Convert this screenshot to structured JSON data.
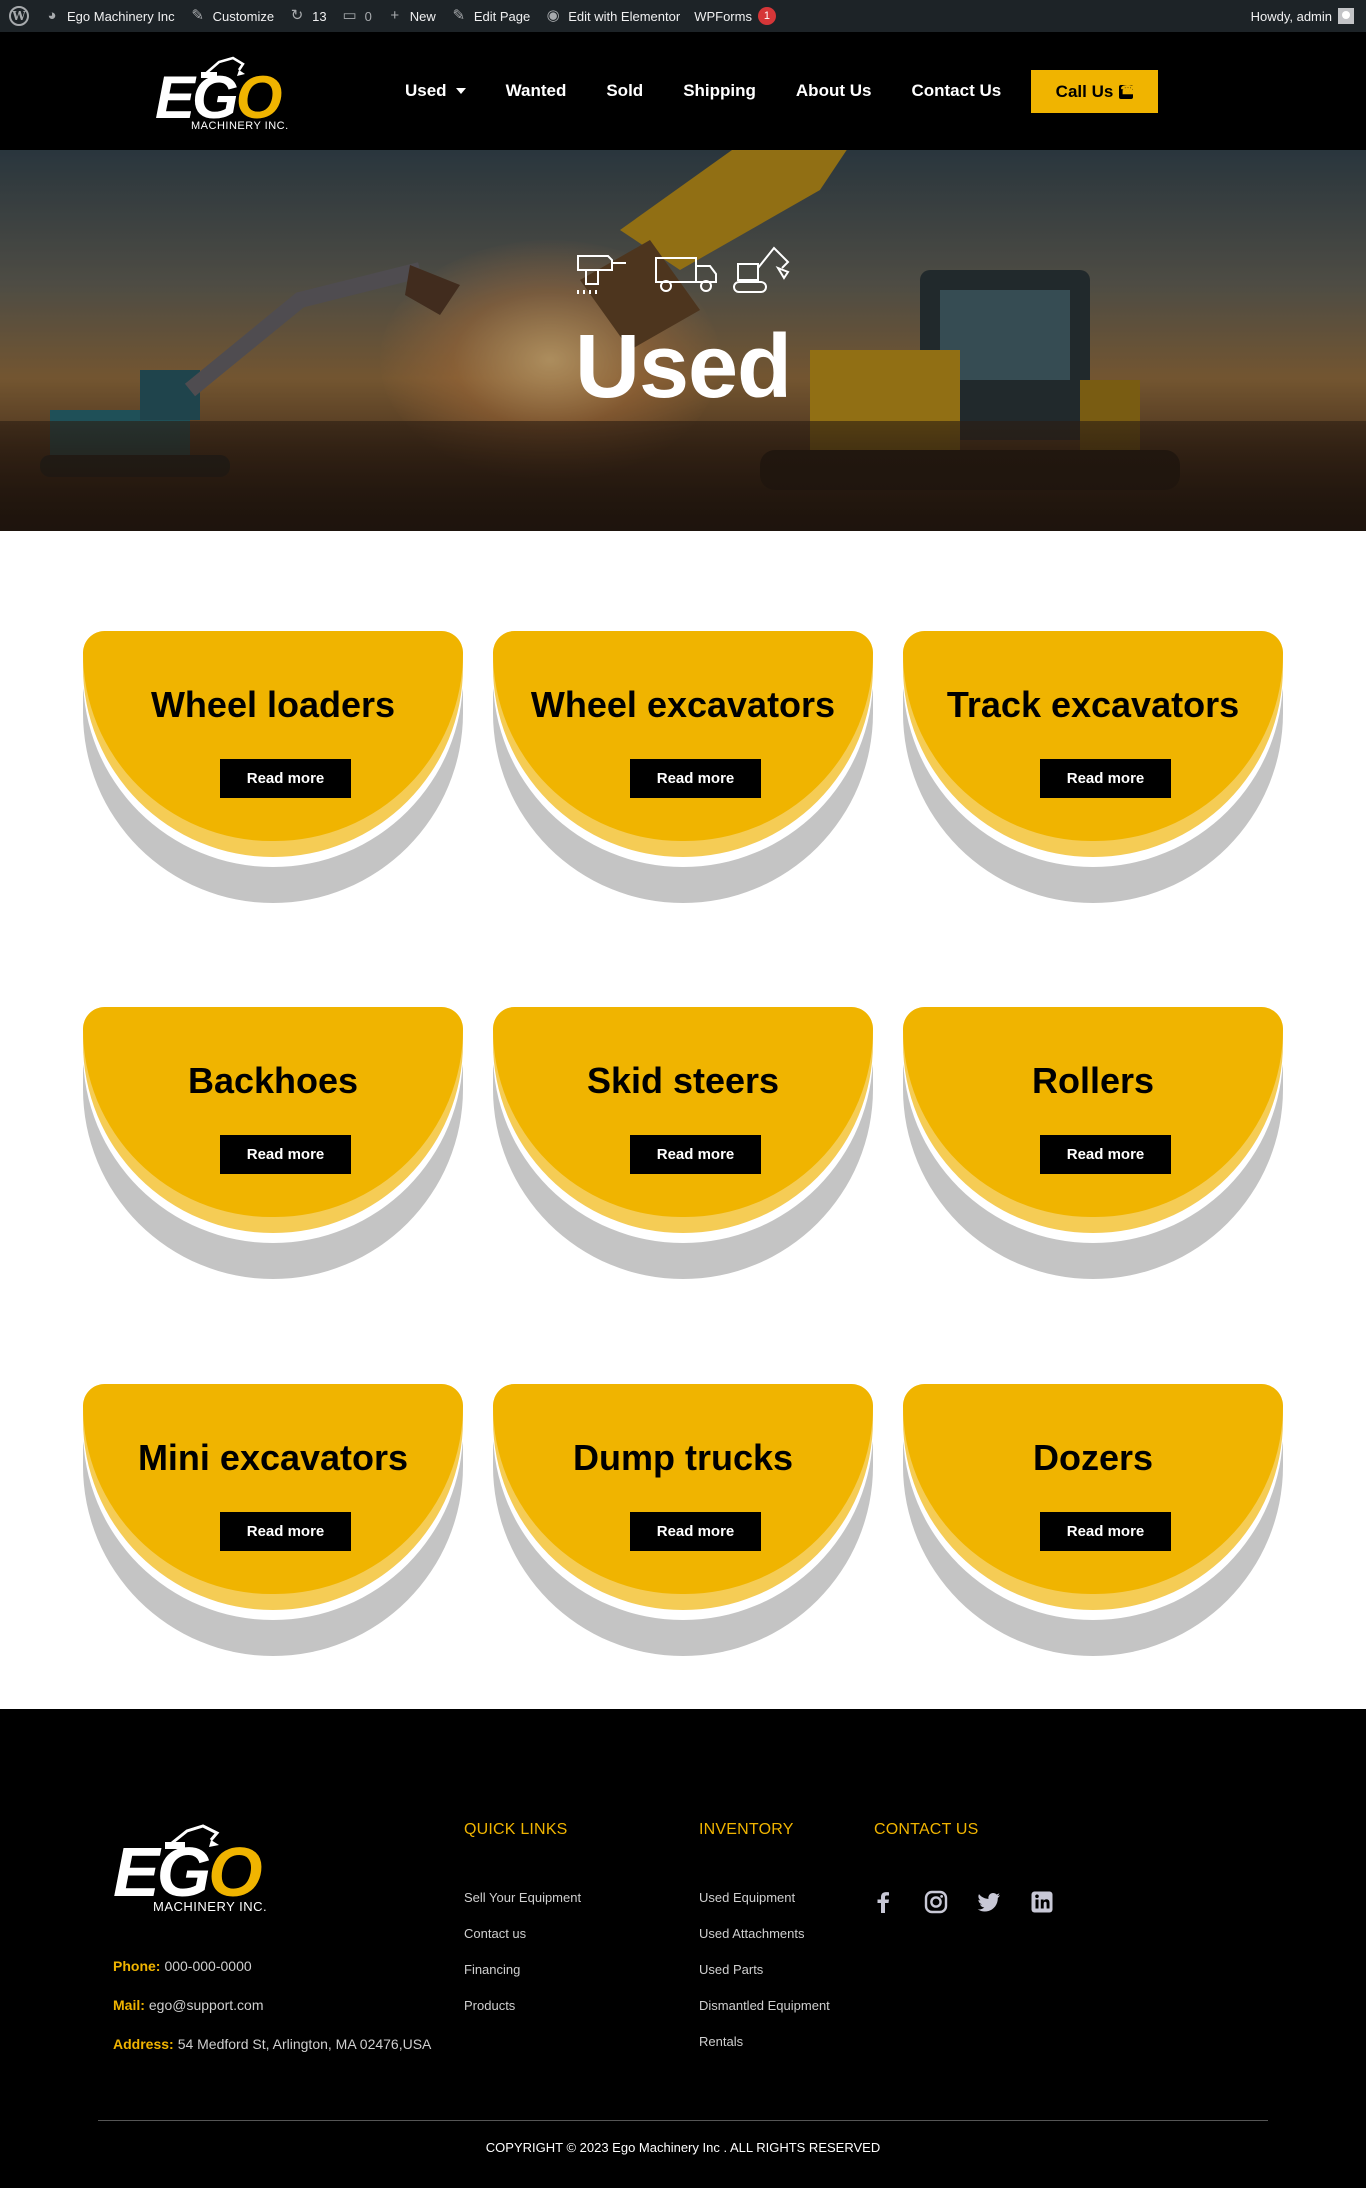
{
  "adminbar": {
    "site_name": "Ego Machinery Inc",
    "customize": "Customize",
    "updates_count": "13",
    "comments_count": "0",
    "new_label": "New",
    "edit_page": "Edit Page",
    "edit_elementor": "Edit with Elementor",
    "wpforms": "WPForms",
    "wpforms_badge": "1",
    "howdy": "Howdy, admin"
  },
  "header": {
    "logo_word_white": "EG",
    "logo_word_yellow": "O",
    "logo_sub": "MACHINERY INC.",
    "nav": [
      "Used",
      "Wanted",
      "Sold",
      "Shipping",
      "About Us",
      "Contact Us"
    ],
    "call_button": "Call Us"
  },
  "hero": {
    "title": "Used"
  },
  "categories": [
    {
      "title": "Wheel loaders",
      "button": "Read more"
    },
    {
      "title": "Wheel excavators",
      "button": "Read more"
    },
    {
      "title": "Track excavators",
      "button": "Read more"
    },
    {
      "title": "Backhoes",
      "button": "Read more"
    },
    {
      "title": "Skid steers",
      "button": "Read more"
    },
    {
      "title": "Rollers",
      "button": "Read more"
    },
    {
      "title": "Mini excavators",
      "button": "Read more"
    },
    {
      "title": "Dump trucks",
      "button": "Read more"
    },
    {
      "title": "Dozers",
      "button": "Read more"
    }
  ],
  "footer": {
    "logo_word_white": "EG",
    "logo_word_yellow": "O",
    "logo_sub": "MACHINERY INC.",
    "phone_label": "Phone:",
    "phone_value": "000-000-0000",
    "mail_label": "Mail:",
    "mail_value": "ego@support.com",
    "address_label": "Address:",
    "address_value": "54 Medford St, Arlington, MA 02476,USA",
    "quick_links_title": "QUICK LINKS",
    "quick_links": [
      "Sell Your Equipment",
      "Contact us",
      "Financing",
      "Products"
    ],
    "inventory_title": "INVENTORY",
    "inventory_links": [
      "Used Equipment",
      "Used Attachments",
      "Used Parts",
      "Dismantled Equipment",
      "Rentals"
    ],
    "contact_title": "CONTACT US",
    "social_icons": [
      "facebook-icon",
      "instagram-icon",
      "twitter-icon",
      "linkedin-icon"
    ],
    "copyright": "COPYRIGHT © 2023 Ego Machinery Inc . ALL RIGHTS RESERVED"
  },
  "colors": {
    "brand_yellow": "#f0b400",
    "header_bg": "#000000",
    "adminbar_bg": "#1d2327"
  }
}
